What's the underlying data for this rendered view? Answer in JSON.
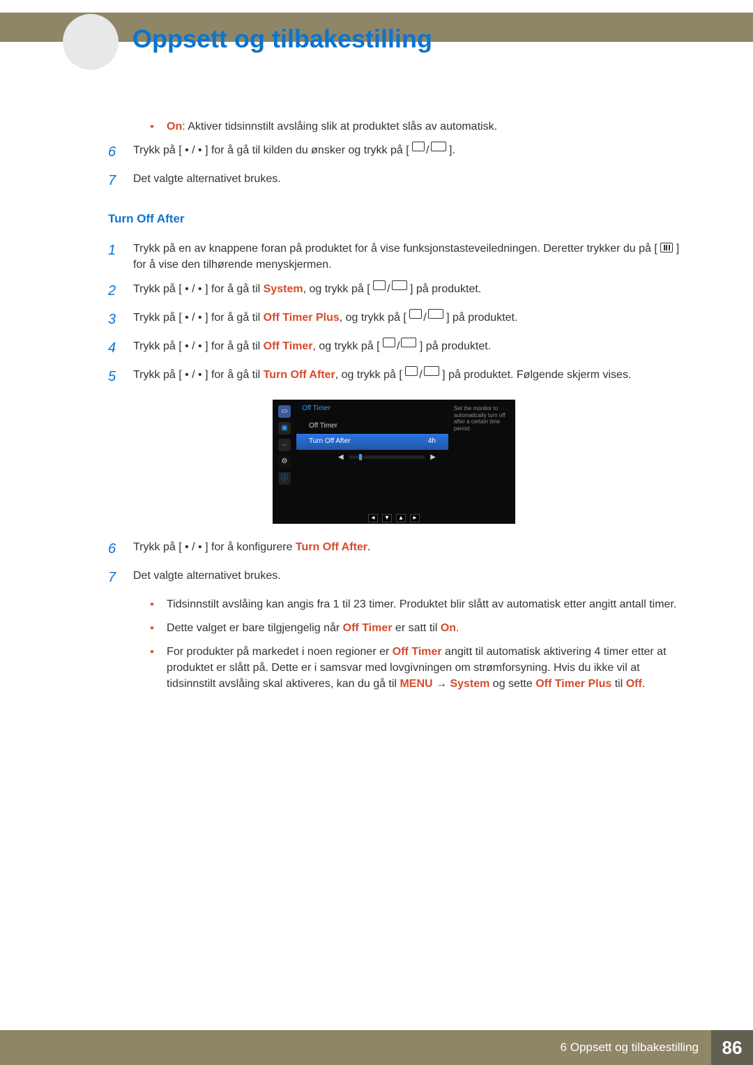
{
  "header": {
    "title": "Oppsett og tilbakestilling",
    "chapter_number": ""
  },
  "pre_steps": {
    "on_bullet_label": "On",
    "on_bullet_text": ": Aktiver tidsinnstilt avslåing slik at produktet slås av automatisk.",
    "step6": "Trykk på [ • / • ] for å gå til kilden du ønsker og trykk på [",
    "step6_tail": "].",
    "step7": "Det valgte alternativet brukes."
  },
  "subhead": "Turn Off After",
  "steps": {
    "1": {
      "a": "Trykk på en av knappene foran på produktet for å vise funksjonstasteveiledningen. Deretter trykker du på [ ",
      "b": " ] for å vise den tilhørende menyskjermen."
    },
    "2": {
      "a": "Trykk på [ • / • ] for å gå til ",
      "k": "System",
      "b": ", og trykk på [",
      "c": "] på produktet."
    },
    "3": {
      "a": "Trykk på [ • / • ] for å gå til ",
      "k": "Off Timer Plus",
      "b": ", og trykk på [",
      "c": "] på produktet."
    },
    "4": {
      "a": "Trykk på [ • / • ] for å gå til ",
      "k": "Off Timer",
      "b": ", og trykk på [",
      "c": "] på produktet."
    },
    "5": {
      "a": "Trykk på [ • / • ] for å gå til ",
      "k": "Turn Off After",
      "b": ", og trykk på [",
      "c": "] på produktet. Følgende skjerm vises."
    },
    "6": {
      "a": "Trykk på [ • / • ] for å konfigurere ",
      "k": "Turn Off After",
      "b": "."
    },
    "7": "Det valgte alternativet brukes."
  },
  "osd": {
    "title": "Off Timer",
    "row1": "Off Timer",
    "row2_label": "Turn Off After",
    "row2_value": "4h",
    "help": "Set the monitor to automatically turn off after a certain time period."
  },
  "notes": {
    "n1": "Tidsinnstilt avslåing kan angis fra 1 til 23 timer. Produktet blir slått av automatisk etter angitt antall timer.",
    "n2_a": "Dette valget er bare tilgjengelig når ",
    "n2_k1": "Off Timer",
    "n2_b": " er satt til ",
    "n2_k2": "On",
    "n2_c": ".",
    "n3_a": "For produkter på markedet i noen regioner er ",
    "n3_k1": "Off Timer",
    "n3_b": " angitt til automatisk aktivering 4 timer etter at produktet er slått på. Dette er i samsvar med lovgivningen om strømforsyning. Hvis du ikke vil at tidsinnstilt avslåing skal aktiveres, kan du gå til ",
    "n3_k2": "MENU",
    "n3_arrow": " → ",
    "n3_k3": "System",
    "n3_c": " og sette ",
    "n3_k4": "Off Timer Plus",
    "n3_d": " til ",
    "n3_k5": "Off",
    "n3_e": "."
  },
  "footer": {
    "title": "6 Oppsett og tilbakestilling",
    "page": "86"
  }
}
